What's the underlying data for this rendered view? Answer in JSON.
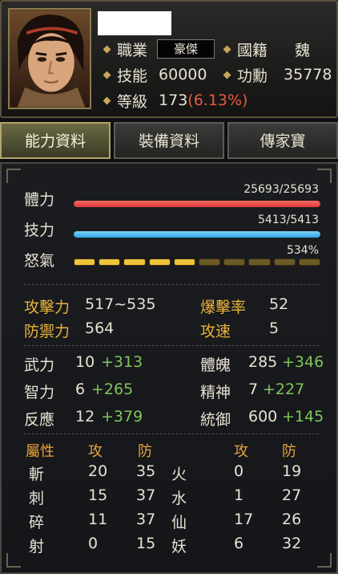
{
  "header": {
    "job_label": "職業",
    "job_value": "豪傑",
    "nation_label": "國籍",
    "nation_value": "魏",
    "skill_label": "技能",
    "skill_value": "60000",
    "merit_label": "功勳",
    "merit_value": "35778",
    "level_label": "等級",
    "level_value": "173",
    "level_pct": "(6.13%)"
  },
  "tabs": [
    {
      "label": "能力資料",
      "active": true
    },
    {
      "label": "裝備資料",
      "active": false
    },
    {
      "label": "傳家寶",
      "active": false
    }
  ],
  "bars": {
    "hp": {
      "label": "體力",
      "value": "25693/25693",
      "fraction": 1.0
    },
    "mp": {
      "label": "技力",
      "value": "5413/5413",
      "fraction": 1.0
    },
    "rage": {
      "label": "怒氣",
      "value": "534%",
      "segments_total": 10,
      "segments_filled": 5
    }
  },
  "combat": {
    "attack_label": "攻擊力",
    "attack_value": "517~535",
    "crit_label": "爆擊率",
    "crit_value": "52",
    "defense_label": "防禦力",
    "defense_value": "564",
    "speed_label": "攻速",
    "speed_value": "5"
  },
  "attributes": [
    {
      "label": "武力",
      "base": "10",
      "bonus": "+313"
    },
    {
      "label": "智力",
      "base": "6",
      "bonus": "+265"
    },
    {
      "label": "反應",
      "base": "12",
      "bonus": "+379"
    },
    {
      "label": "體魄",
      "base": "285",
      "bonus": "+346"
    },
    {
      "label": "精神",
      "base": "7",
      "bonus": "+227"
    },
    {
      "label": "統御",
      "base": "600",
      "bonus": "+145"
    }
  ],
  "elements": {
    "header_attr": "屬性",
    "header_atk": "攻",
    "header_def": "防",
    "rows": [
      {
        "l_name": "斬",
        "l_atk": "20",
        "l_def": "35",
        "r_name": "火",
        "r_atk": "0",
        "r_def": "19"
      },
      {
        "l_name": "刺",
        "l_atk": "15",
        "l_def": "37",
        "r_name": "水",
        "r_atk": "1",
        "r_def": "27"
      },
      {
        "l_name": "碎",
        "l_atk": "11",
        "l_def": "37",
        "r_name": "仙",
        "r_atk": "17",
        "r_def": "26"
      },
      {
        "l_name": "射",
        "l_atk": "0",
        "l_def": "15",
        "r_name": "妖",
        "r_atk": "6",
        "r_def": "32"
      }
    ]
  },
  "colors": {
    "hp_bar": "#e0393a",
    "mp_bar": "#2ea4e8",
    "rage_on": "#f0c43a",
    "rage_off": "#6b5a26",
    "bonus_green": "#7fc65a",
    "combat_gold": "#e8b33a",
    "element_header": "#e8a23a"
  }
}
